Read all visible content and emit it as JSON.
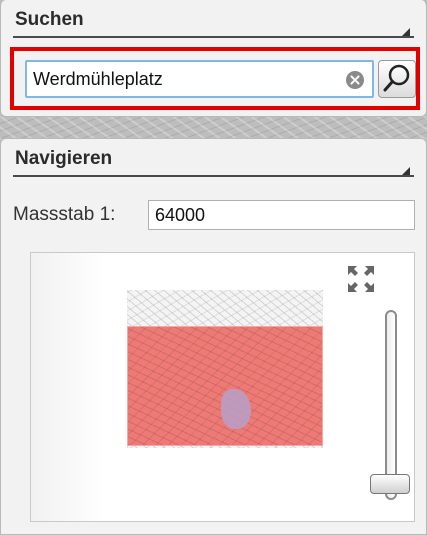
{
  "search_panel": {
    "title": "Suchen",
    "query_value": "Werdmühleplatz",
    "collapse_icon": "collapse-triangle-icon",
    "clear_icon": "clear-icon",
    "search_icon": "magnifier-icon",
    "highlight_color": "#e30000"
  },
  "nav_panel": {
    "title": "Navigieren",
    "collapse_icon": "collapse-triangle-icon",
    "scale_label": "Massstab 1:",
    "scale_value": "64000",
    "fullextent_icon": "full-extent-icon",
    "viewport_color": "#ef7a75"
  }
}
